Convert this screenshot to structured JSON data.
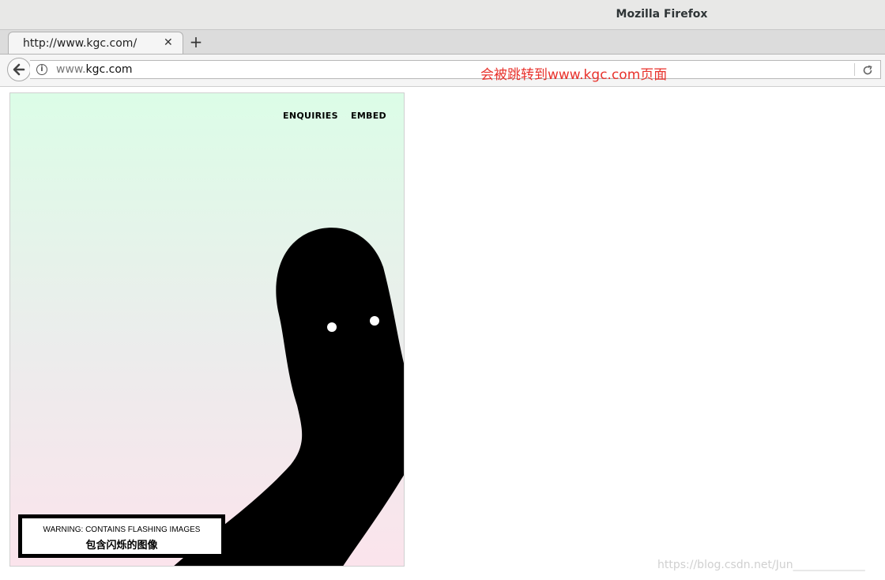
{
  "window": {
    "title": "Mozilla Firefox"
  },
  "tabs": [
    {
      "label": "http://www.kgc.com/",
      "close": "✕"
    }
  ],
  "new_tab_label": "+",
  "navbar": {
    "url_prefix": "www.",
    "url_domain": "kgc.com"
  },
  "annotation": "会被跳转到www.kgc.com页面",
  "page": {
    "nav": {
      "enquiries": "ENQUIRIES",
      "embed": "EMBED"
    },
    "warning": {
      "line1": "WARNING: CONTAINS FLASHING IMAGES",
      "line2": "包含闪烁的图像"
    }
  },
  "watermark": "https://blog.csdn.net/Jun_____________",
  "colors": {
    "annotation": "#e8322c",
    "creature": "#000000"
  },
  "icons": {
    "back": "arrow-left-icon",
    "info": "info-icon",
    "reload": "reload-icon",
    "close": "close-icon"
  }
}
